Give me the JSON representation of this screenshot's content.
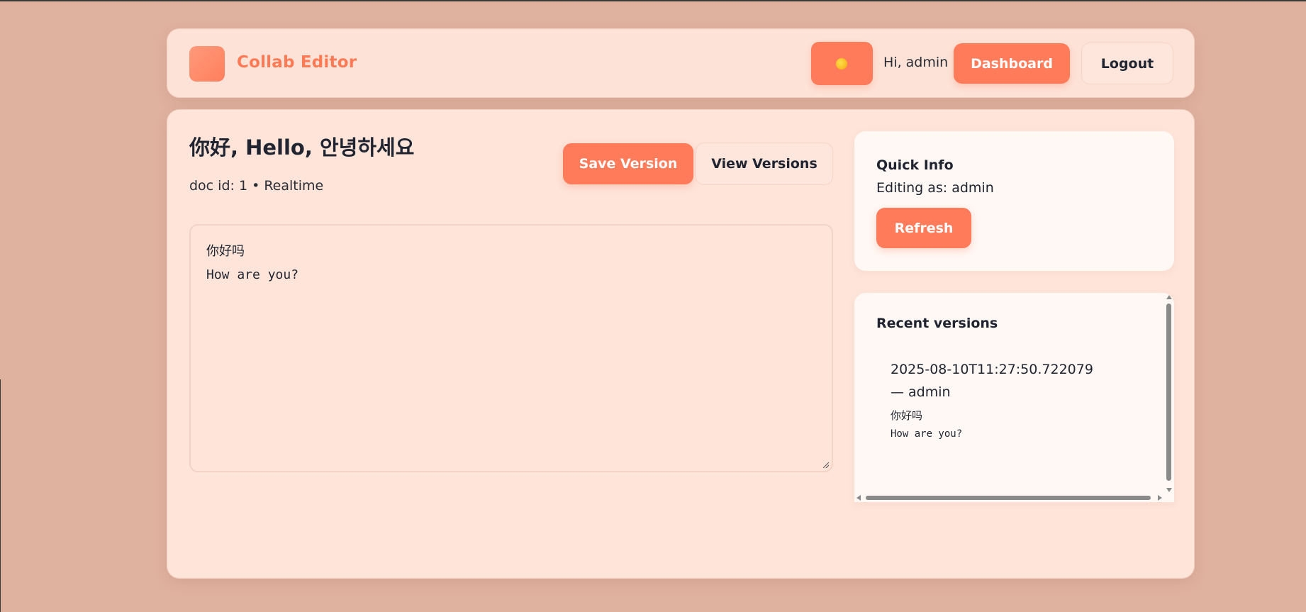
{
  "header": {
    "brand": "Collab Editor",
    "theme_icon": "sun-icon",
    "greeting": "Hi, admin",
    "dashboard_label": "Dashboard",
    "logout_label": "Logout"
  },
  "document": {
    "title": "你好, Hello, 안녕하세요",
    "meta": "doc id: 1 • Realtime",
    "save_label": "Save Version",
    "view_label": "View Versions",
    "content": "你好吗\nHow are you?"
  },
  "quick_info": {
    "title": "Quick Info",
    "editing": "Editing as: admin",
    "refresh_label": "Refresh"
  },
  "recent_versions": {
    "title": "Recent versions",
    "items": [
      {
        "header": "2025-08-10T11:27:50.722079 — admin",
        "line1": "你好吗",
        "line2": "How are you?"
      }
    ]
  },
  "colors": {
    "background": "#dfb19f",
    "card": "#fde3d7",
    "accent": "#ff7b5a",
    "brand_text": "#ff7a55"
  }
}
